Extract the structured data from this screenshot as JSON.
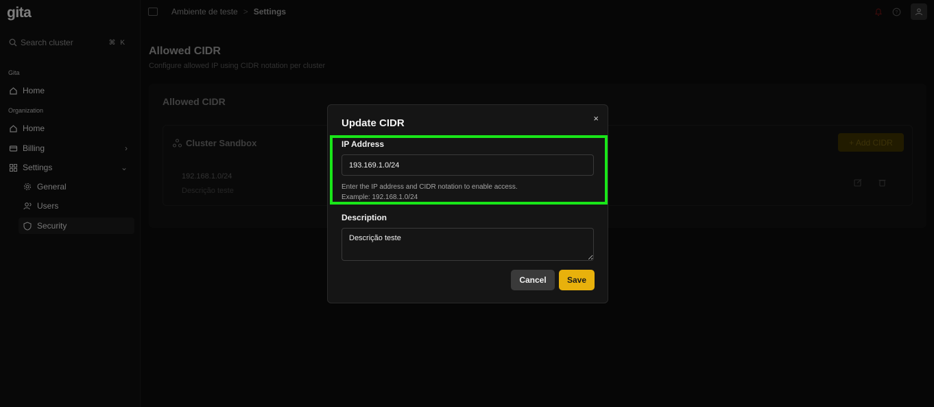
{
  "app": {
    "logo": "gita"
  },
  "search": {
    "placeholder": "Search cluster",
    "shortcut": "⌘ K"
  },
  "sidebar": {
    "section_gita": "Gita",
    "home_gita": "Home",
    "section_org": "Organization",
    "home_org": "Home",
    "billing": "Billing",
    "settings": "Settings",
    "general": "General",
    "users": "Users",
    "security": "Security"
  },
  "breadcrumb": {
    "project": "Ambiente de teste",
    "separator": ">",
    "current": "Settings"
  },
  "page": {
    "title": "Allowed CIDR",
    "subtitle": "Configure allowed IP using CIDR notation per cluster"
  },
  "card": {
    "title": "Allowed CIDR",
    "cluster_name": "Cluster Sandbox",
    "add_button": "+ Add CIDR",
    "entry": {
      "ip": "192.168.1.0/24",
      "description": "Descrição teste"
    }
  },
  "modal": {
    "title": "Update CIDR",
    "ip_label": "IP Address",
    "ip_value": "193.169.1.0/24",
    "help_line1": "Enter the IP address and CIDR notation to enable access.",
    "help_line2": "Example: 192.168.1.0/24",
    "description_label": "Description",
    "description_value": "Descrição teste",
    "cancel_label": "Cancel",
    "save_label": "Save",
    "close_symbol": "×"
  },
  "colors": {
    "accent": "#e8b10c",
    "highlight": "#19e619",
    "background": "#0b0b0b"
  }
}
